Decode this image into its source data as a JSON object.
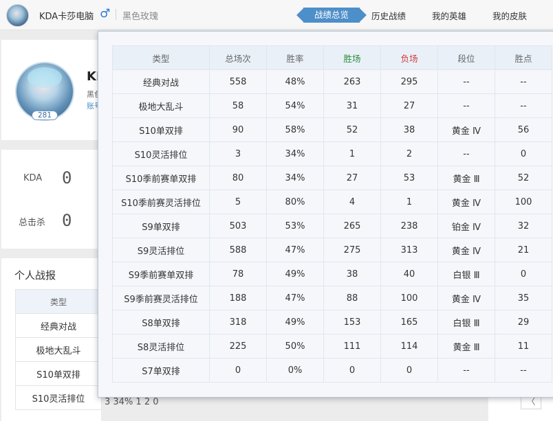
{
  "header": {
    "name": "KDA卡莎电脑",
    "gender_symbol": "♂",
    "server": "黑色玫瑰",
    "tabs": [
      {
        "label": "战绩总览",
        "active": true
      },
      {
        "label": "历史战绩",
        "active": false
      },
      {
        "label": "我的英雄",
        "active": false
      },
      {
        "label": "我的皮肤",
        "active": false
      }
    ]
  },
  "profile": {
    "level": "281",
    "name_partial": "KI",
    "sub_partial_1": "黑色",
    "sub_partial_2": "账号"
  },
  "stats": [
    {
      "label": "KDA",
      "value": "0"
    },
    {
      "label": "总击杀",
      "value": "0"
    }
  ],
  "report": {
    "title": "个人战报",
    "table": {
      "header": "类型",
      "rows": [
        "经典对战",
        "极地大乱斗",
        "S10单双排",
        "S10灵活排位"
      ],
      "partial_bottom": "3    34%    1    2    0"
    }
  },
  "pager": {
    "prev": "〈"
  },
  "overview": {
    "columns": [
      "类型",
      "总场次",
      "胜率",
      "胜场",
      "负场",
      "段位",
      "胜点"
    ],
    "colors": {
      "wins": "#2a8a3a",
      "losses": "#d13a3a"
    },
    "rows": [
      [
        "经典对战",
        "558",
        "48%",
        "263",
        "295",
        "--",
        "--"
      ],
      [
        "极地大乱斗",
        "58",
        "54%",
        "31",
        "27",
        "--",
        "--"
      ],
      [
        "S10单双排",
        "90",
        "58%",
        "52",
        "38",
        "黄金 Ⅳ",
        "56"
      ],
      [
        "S10灵活排位",
        "3",
        "34%",
        "1",
        "2",
        "--",
        "0"
      ],
      [
        "S10季前赛单双排",
        "80",
        "34%",
        "27",
        "53",
        "黄金 Ⅲ",
        "52"
      ],
      [
        "S10季前赛灵活排位",
        "5",
        "80%",
        "4",
        "1",
        "黄金 Ⅳ",
        "100"
      ],
      [
        "S9单双排",
        "503",
        "53%",
        "265",
        "238",
        "铂金 Ⅳ",
        "32"
      ],
      [
        "S9灵活排位",
        "588",
        "47%",
        "275",
        "313",
        "黄金 Ⅳ",
        "21"
      ],
      [
        "S9季前赛单双排",
        "78",
        "49%",
        "38",
        "40",
        "白银 Ⅲ",
        "0"
      ],
      [
        "S9季前赛灵活排位",
        "188",
        "47%",
        "88",
        "100",
        "黄金 Ⅳ",
        "35"
      ],
      [
        "S8单双排",
        "318",
        "49%",
        "153",
        "165",
        "白银 Ⅲ",
        "29"
      ],
      [
        "S8灵活排位",
        "225",
        "50%",
        "111",
        "114",
        "黄金 Ⅲ",
        "11"
      ],
      [
        "S7单双排",
        "0",
        "0%",
        "0",
        "0",
        "--",
        "--"
      ]
    ]
  }
}
